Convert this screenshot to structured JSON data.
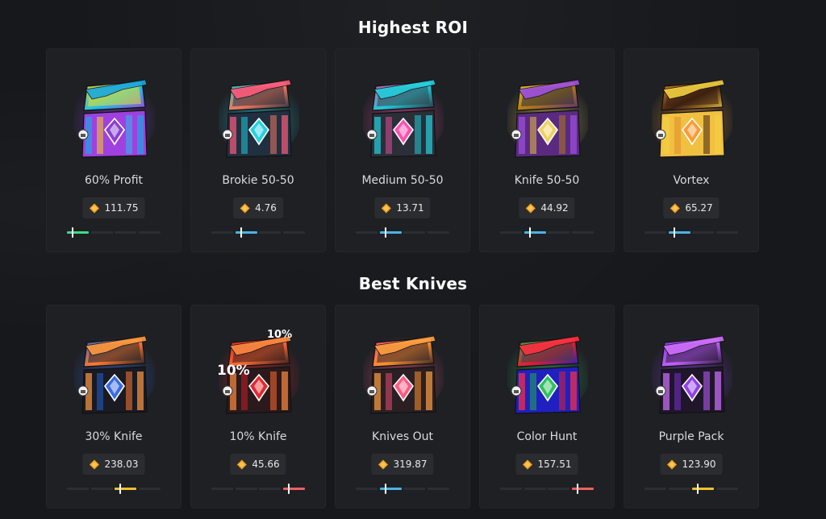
{
  "sections": [
    {
      "title": "Highest ROI",
      "cards": [
        {
          "name": "60% Profit",
          "price": "111.75",
          "icon": "colorful-splash-case",
          "risk_level": 0.22,
          "risk_color": "#3ddc84"
        },
        {
          "name": "Brokie 50-50",
          "price": "4.76",
          "icon": "teal-octopus-case",
          "risk_level": 0.48,
          "risk_color": "#4bb3e6"
        },
        {
          "name": "Medium 50-50",
          "price": "13.71",
          "icon": "pink-teal-case",
          "risk_level": 0.48,
          "risk_color": "#4bb3e6"
        },
        {
          "name": "Knife 50-50",
          "price": "44.92",
          "icon": "gold-knife-case",
          "risk_level": 0.48,
          "risk_color": "#4bb3e6"
        },
        {
          "name": "Vortex",
          "price": "65.27",
          "icon": "orange-vortex-case",
          "risk_level": 0.48,
          "risk_color": "#4bb3e6"
        }
      ]
    },
    {
      "title": "Best Knives",
      "cards": [
        {
          "name": "30% Knife",
          "price": "238.03",
          "icon": "blue-karambit-case",
          "risk_level": 0.75,
          "risk_color": "#f2c12e"
        },
        {
          "name": "10% Knife",
          "price": "45.66",
          "icon": "red-knife-case",
          "risk_level": 1.0,
          "risk_color": "#f06060"
        },
        {
          "name": "Knives Out",
          "price": "319.87",
          "icon": "orange-knives-case",
          "risk_level": 0.5,
          "risk_color": "#4bb3e6"
        },
        {
          "name": "Color Hunt",
          "price": "157.51",
          "icon": "green-red-knives-case",
          "risk_level": 1.0,
          "risk_color": "#f06060"
        },
        {
          "name": "Purple Pack",
          "price": "123.90",
          "icon": "purple-case",
          "risk_level": 0.75,
          "risk_color": "#f2c12e"
        }
      ]
    }
  ],
  "overlay_text": {
    "ten_percent_small": "10%",
    "ten_percent_big": "10%"
  },
  "colors": {
    "background": "#16181b",
    "card": "#1e2024",
    "coin": "#f0a020"
  }
}
